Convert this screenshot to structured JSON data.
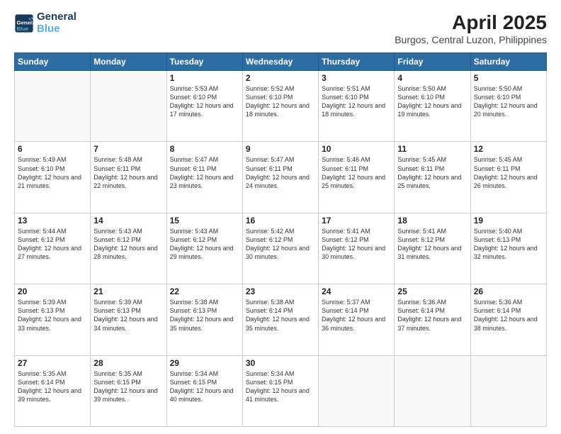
{
  "logo": {
    "line1": "General",
    "line2": "Blue"
  },
  "title": "April 2025",
  "subtitle": "Burgos, Central Luzon, Philippines",
  "weekdays": [
    "Sunday",
    "Monday",
    "Tuesday",
    "Wednesday",
    "Thursday",
    "Friday",
    "Saturday"
  ],
  "weeks": [
    [
      {
        "day": "",
        "info": ""
      },
      {
        "day": "",
        "info": ""
      },
      {
        "day": "1",
        "info": "Sunrise: 5:53 AM\nSunset: 6:10 PM\nDaylight: 12 hours and 17 minutes."
      },
      {
        "day": "2",
        "info": "Sunrise: 5:52 AM\nSunset: 6:10 PM\nDaylight: 12 hours and 18 minutes."
      },
      {
        "day": "3",
        "info": "Sunrise: 5:51 AM\nSunset: 6:10 PM\nDaylight: 12 hours and 18 minutes."
      },
      {
        "day": "4",
        "info": "Sunrise: 5:50 AM\nSunset: 6:10 PM\nDaylight: 12 hours and 19 minutes."
      },
      {
        "day": "5",
        "info": "Sunrise: 5:50 AM\nSunset: 6:10 PM\nDaylight: 12 hours and 20 minutes."
      }
    ],
    [
      {
        "day": "6",
        "info": "Sunrise: 5:49 AM\nSunset: 6:10 PM\nDaylight: 12 hours and 21 minutes."
      },
      {
        "day": "7",
        "info": "Sunrise: 5:48 AM\nSunset: 6:11 PM\nDaylight: 12 hours and 22 minutes."
      },
      {
        "day": "8",
        "info": "Sunrise: 5:47 AM\nSunset: 6:11 PM\nDaylight: 12 hours and 23 minutes."
      },
      {
        "day": "9",
        "info": "Sunrise: 5:47 AM\nSunset: 6:11 PM\nDaylight: 12 hours and 24 minutes."
      },
      {
        "day": "10",
        "info": "Sunrise: 5:46 AM\nSunset: 6:11 PM\nDaylight: 12 hours and 25 minutes."
      },
      {
        "day": "11",
        "info": "Sunrise: 5:45 AM\nSunset: 6:11 PM\nDaylight: 12 hours and 25 minutes."
      },
      {
        "day": "12",
        "info": "Sunrise: 5:45 AM\nSunset: 6:11 PM\nDaylight: 12 hours and 26 minutes."
      }
    ],
    [
      {
        "day": "13",
        "info": "Sunrise: 5:44 AM\nSunset: 6:12 PM\nDaylight: 12 hours and 27 minutes."
      },
      {
        "day": "14",
        "info": "Sunrise: 5:43 AM\nSunset: 6:12 PM\nDaylight: 12 hours and 28 minutes."
      },
      {
        "day": "15",
        "info": "Sunrise: 5:43 AM\nSunset: 6:12 PM\nDaylight: 12 hours and 29 minutes."
      },
      {
        "day": "16",
        "info": "Sunrise: 5:42 AM\nSunset: 6:12 PM\nDaylight: 12 hours and 30 minutes."
      },
      {
        "day": "17",
        "info": "Sunrise: 5:41 AM\nSunset: 6:12 PM\nDaylight: 12 hours and 30 minutes."
      },
      {
        "day": "18",
        "info": "Sunrise: 5:41 AM\nSunset: 6:12 PM\nDaylight: 12 hours and 31 minutes."
      },
      {
        "day": "19",
        "info": "Sunrise: 5:40 AM\nSunset: 6:13 PM\nDaylight: 12 hours and 32 minutes."
      }
    ],
    [
      {
        "day": "20",
        "info": "Sunrise: 5:39 AM\nSunset: 6:13 PM\nDaylight: 12 hours and 33 minutes."
      },
      {
        "day": "21",
        "info": "Sunrise: 5:39 AM\nSunset: 6:13 PM\nDaylight: 12 hours and 34 minutes."
      },
      {
        "day": "22",
        "info": "Sunrise: 5:38 AM\nSunset: 6:13 PM\nDaylight: 12 hours and 35 minutes."
      },
      {
        "day": "23",
        "info": "Sunrise: 5:38 AM\nSunset: 6:14 PM\nDaylight: 12 hours and 35 minutes."
      },
      {
        "day": "24",
        "info": "Sunrise: 5:37 AM\nSunset: 6:14 PM\nDaylight: 12 hours and 36 minutes."
      },
      {
        "day": "25",
        "info": "Sunrise: 5:36 AM\nSunset: 6:14 PM\nDaylight: 12 hours and 37 minutes."
      },
      {
        "day": "26",
        "info": "Sunrise: 5:36 AM\nSunset: 6:14 PM\nDaylight: 12 hours and 38 minutes."
      }
    ],
    [
      {
        "day": "27",
        "info": "Sunrise: 5:35 AM\nSunset: 6:14 PM\nDaylight: 12 hours and 39 minutes."
      },
      {
        "day": "28",
        "info": "Sunrise: 5:35 AM\nSunset: 6:15 PM\nDaylight: 12 hours and 39 minutes."
      },
      {
        "day": "29",
        "info": "Sunrise: 5:34 AM\nSunset: 6:15 PM\nDaylight: 12 hours and 40 minutes."
      },
      {
        "day": "30",
        "info": "Sunrise: 5:34 AM\nSunset: 6:15 PM\nDaylight: 12 hours and 41 minutes."
      },
      {
        "day": "",
        "info": ""
      },
      {
        "day": "",
        "info": ""
      },
      {
        "day": "",
        "info": ""
      }
    ]
  ]
}
